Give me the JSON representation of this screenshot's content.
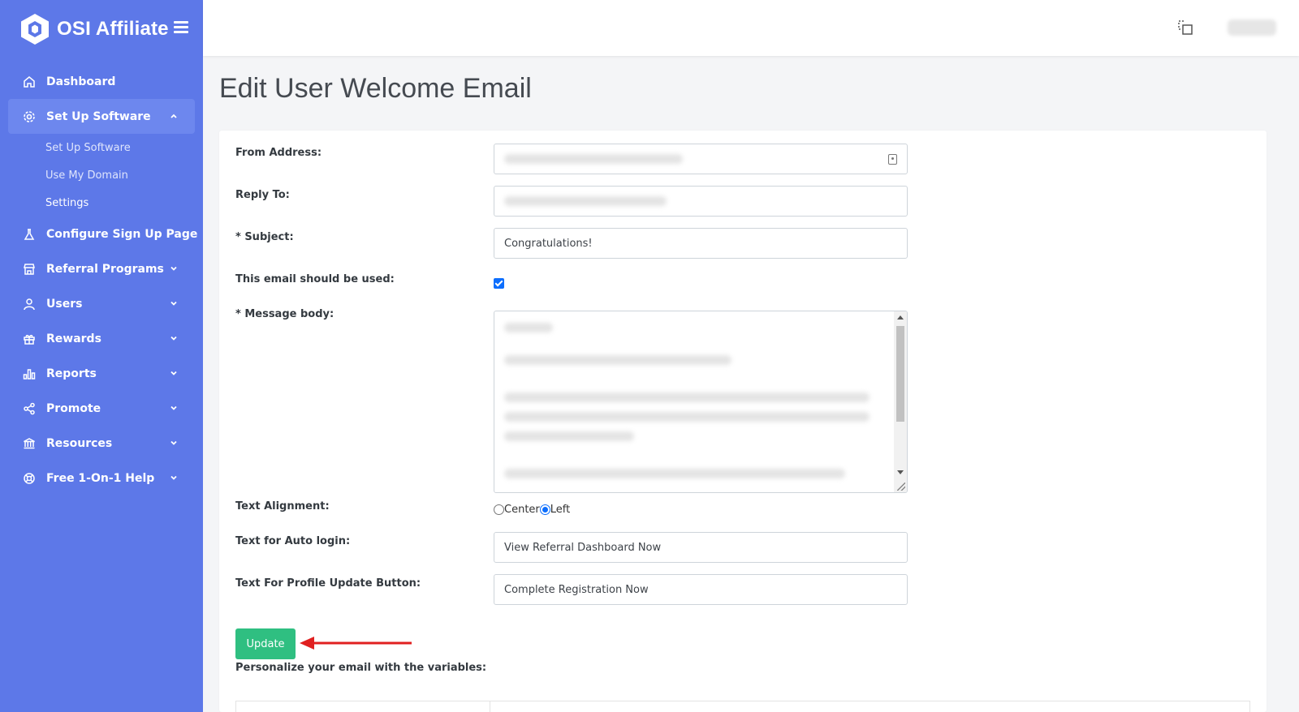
{
  "app": {
    "brand": "OSI Affiliate",
    "accent_color": "#5d78e8",
    "button_color": "#2fbf81"
  },
  "sidebar": {
    "items": [
      {
        "label": "Dashboard",
        "icon": "home-icon"
      },
      {
        "label": "Set Up Software",
        "icon": "gear-icon",
        "expanded": true,
        "children": [
          {
            "label": "Set Up Software"
          },
          {
            "label": "Use My Domain"
          },
          {
            "label": "Settings"
          }
        ]
      },
      {
        "label": "Configure Sign Up Page",
        "icon": "flask-icon"
      },
      {
        "label": "Referral Programs",
        "icon": "store-icon"
      },
      {
        "label": "Users",
        "icon": "user-icon"
      },
      {
        "label": "Rewards",
        "icon": "gift-icon"
      },
      {
        "label": "Reports",
        "icon": "bar-chart-icon"
      },
      {
        "label": "Promote",
        "icon": "share-icon"
      },
      {
        "label": "Resources",
        "icon": "bank-icon"
      },
      {
        "label": "Free 1-On-1 Help",
        "icon": "lifebuoy-icon"
      }
    ]
  },
  "page": {
    "title": "Edit User Welcome Email"
  },
  "form": {
    "from_address_label": "From Address:",
    "reply_to_label": "Reply To:",
    "subject_label": "* Subject:",
    "subject_value": "Congratulations!",
    "use_email_label": "This email should be used:",
    "use_email_checked": true,
    "message_body_label": "* Message body:",
    "text_alignment_label": "Text Alignment:",
    "alignment_options": [
      "Center",
      "Left"
    ],
    "alignment_selected": "Left",
    "auto_login_label": "Text for Auto login:",
    "auto_login_value": "View Referral Dashboard Now",
    "profile_update_label": "Text For Profile Update Button:",
    "profile_update_value": "Complete Registration Now",
    "update_button": "Update",
    "personalize_label": "Personalize your email with the variables:"
  }
}
